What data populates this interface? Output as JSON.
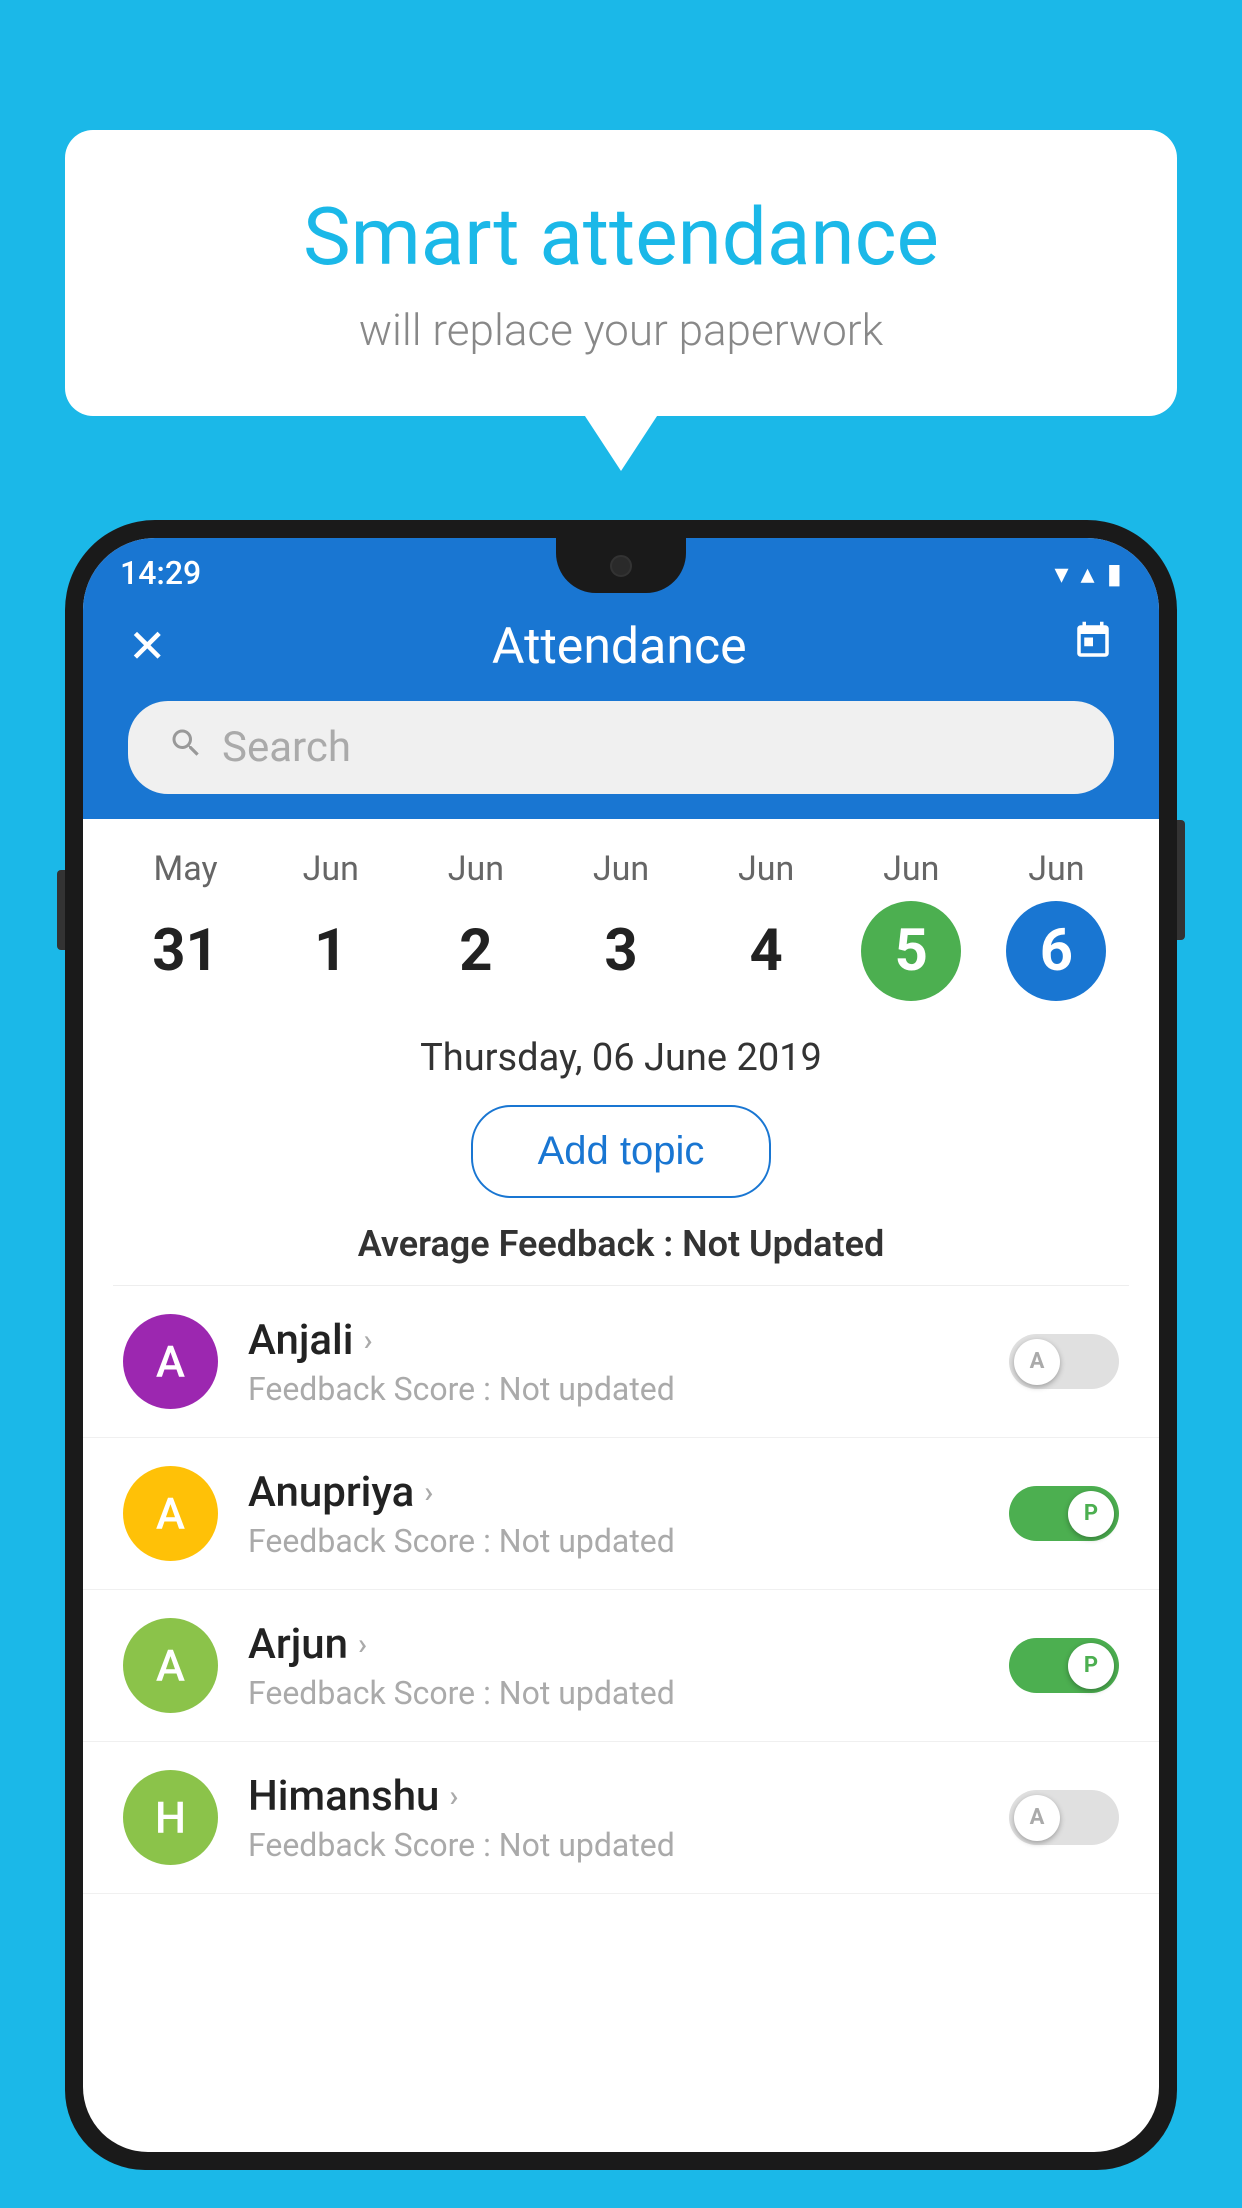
{
  "background_color": "#1BB8E8",
  "bubble": {
    "title": "Smart attendance",
    "subtitle": "will replace your paperwork"
  },
  "status_bar": {
    "time": "14:29",
    "wifi_icon": "▼",
    "signal_icon": "◀",
    "battery_icon": "▮"
  },
  "header": {
    "title": "Attendance",
    "close_label": "✕",
    "calendar_icon": "📅"
  },
  "search": {
    "placeholder": "Search"
  },
  "calendar": {
    "days": [
      {
        "month": "May",
        "date": "31",
        "style": "normal"
      },
      {
        "month": "Jun",
        "date": "1",
        "style": "normal"
      },
      {
        "month": "Jun",
        "date": "2",
        "style": "normal"
      },
      {
        "month": "Jun",
        "date": "3",
        "style": "normal"
      },
      {
        "month": "Jun",
        "date": "4",
        "style": "normal"
      },
      {
        "month": "Jun",
        "date": "5",
        "style": "selected-green"
      },
      {
        "month": "Jun",
        "date": "6",
        "style": "selected-blue"
      }
    ],
    "selected_date": "Thursday, 06 June 2019"
  },
  "add_topic_label": "Add topic",
  "average_feedback": {
    "label": "Average Feedback : ",
    "value": "Not Updated"
  },
  "students": [
    {
      "name": "Anjali",
      "feedback_label": "Feedback Score : ",
      "feedback_value": "Not updated",
      "avatar_letter": "A",
      "avatar_color": "#9C27B0",
      "toggle": "absent",
      "toggle_letter": "A"
    },
    {
      "name": "Anupriya",
      "feedback_label": "Feedback Score : ",
      "feedback_value": "Not updated",
      "avatar_letter": "A",
      "avatar_color": "#FFC107",
      "toggle": "present",
      "toggle_letter": "P"
    },
    {
      "name": "Arjun",
      "feedback_label": "Feedback Score : ",
      "feedback_value": "Not updated",
      "avatar_letter": "A",
      "avatar_color": "#8BC34A",
      "toggle": "present",
      "toggle_letter": "P"
    },
    {
      "name": "Himanshu",
      "feedback_label": "Feedback Score : ",
      "feedback_value": "Not updated",
      "avatar_letter": "H",
      "avatar_color": "#8BC34A",
      "toggle": "absent",
      "toggle_letter": "A"
    }
  ]
}
